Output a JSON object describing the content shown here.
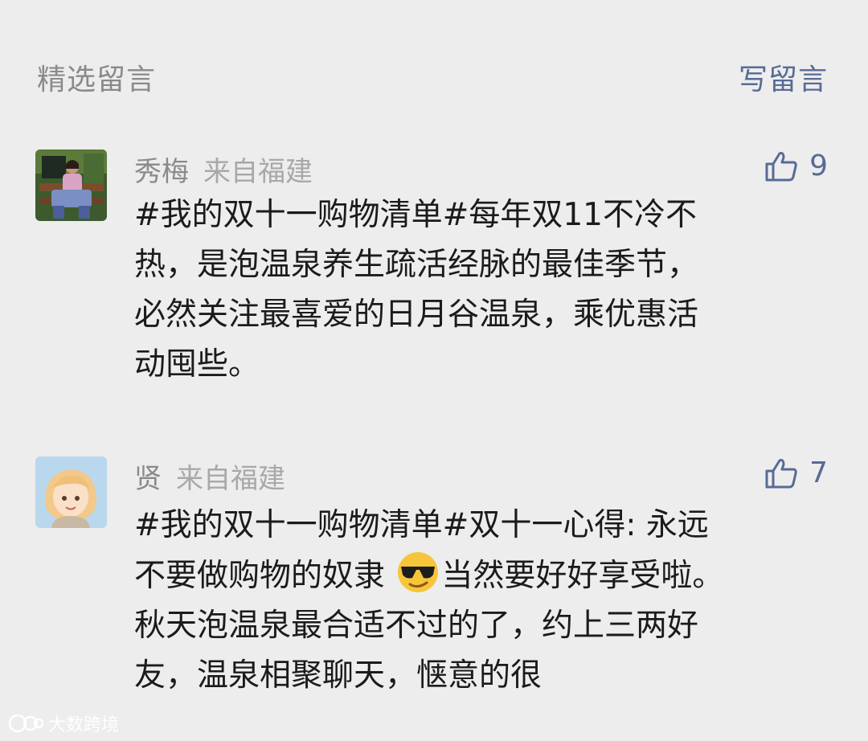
{
  "header": {
    "title": "精选留言",
    "write_label": "写留言"
  },
  "comments": [
    {
      "name": "秀梅",
      "location": "来自福建",
      "likes": "9",
      "lines": [
        "#我的双十一购物清单#每年双11不冷不",
        "热，是泡温泉养生疏活经脉的最佳季节，",
        "必然关注最喜爱的日月谷温泉，乘优惠活",
        "动囤些。"
      ]
    },
    {
      "name": "贤",
      "location": "来自福建",
      "likes": "7",
      "lines": [
        "#我的双十一购物清单#双十一心得: 永远",
        "不要做购物的奴隶",
        "当然要好好享受啦。",
        "秋天泡温泉最合适不过的了，约上三两好",
        "友，温泉相聚聊天，惬意的很"
      ]
    }
  ],
  "watermark": {
    "text": "大数跨境"
  },
  "icons": {
    "like": "thumbs-up-icon",
    "emoji": "sunglasses-emoji-icon"
  },
  "colors": {
    "background": "#ededed",
    "link": "#576b95",
    "muted": "#8a8a8a",
    "text": "#1b1b1b"
  }
}
